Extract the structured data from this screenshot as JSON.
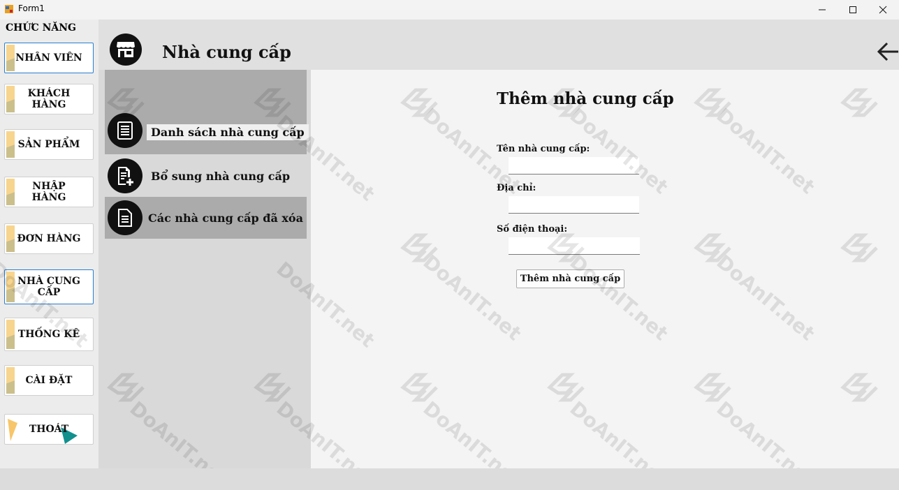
{
  "window": {
    "title": "Form1",
    "minimize_icon": "minimize-icon",
    "maximize_icon": "maximize-icon",
    "close_icon": "close-icon"
  },
  "menu": {
    "title": "CHỨC NĂNG",
    "items": [
      {
        "label": "NHÂN VIÊN",
        "active": true
      },
      {
        "label": "KHÁCH HÀNG",
        "active": false
      },
      {
        "label": "SẢN PHẨM",
        "active": false
      },
      {
        "label": "NHẬP HÀNG",
        "active": false
      },
      {
        "label": "ĐƠN HÀNG",
        "active": false
      },
      {
        "label": "NHÀ CUNG CẤP",
        "active": true
      },
      {
        "label": "THỐNG KÊ",
        "active": false
      },
      {
        "label": "CÀI ĐẶT",
        "active": false
      },
      {
        "label": "THOÁT",
        "active": false
      }
    ]
  },
  "header": {
    "title": "Nhà cung cấp",
    "icon": "store-icon",
    "back_icon": "arrow-left-icon"
  },
  "submenu": {
    "items": [
      {
        "label": "Danh sách nhà cung cấp",
        "icon": "list-document-icon"
      },
      {
        "label": "Bổ sung nhà cung cấp",
        "icon": "add-document-icon"
      },
      {
        "label": "Các nhà cung cấp đã xóa",
        "icon": "deleted-document-icon"
      }
    ]
  },
  "form": {
    "title": "Thêm nhà cung cấp",
    "fields": {
      "name_label": "Tên nhà cung cấp:",
      "name_value": "",
      "address_label": "Địa chỉ:",
      "address_value": "",
      "phone_label": "Số điện thoại:",
      "phone_value": ""
    },
    "submit_label": "Thêm nhà cung cấp"
  },
  "watermark": {
    "text": "DoAnIT.net"
  },
  "colors": {
    "active_border": "#2a7fd0",
    "submenu_highlight": "#ababab",
    "panel_bg": "#f4f4f4"
  }
}
